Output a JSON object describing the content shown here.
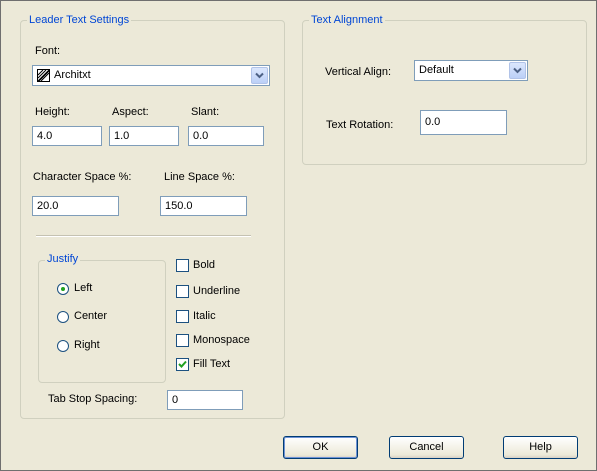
{
  "leader_group": {
    "legend": "Leader Text Settings",
    "font_label": "Font:",
    "font_value": "Architxt",
    "font_icon": "font-glyph-icon",
    "height_label": "Height:",
    "height_value": "4.0",
    "aspect_label": "Aspect:",
    "aspect_value": "1.0",
    "slant_label": "Slant:",
    "slant_value": "0.0",
    "char_space_label": "Character Space %:",
    "char_space_value": "20.0",
    "line_space_label": "Line Space %:",
    "line_space_value": "150.0",
    "justify": {
      "legend": "Justify",
      "options": [
        "Left",
        "Center",
        "Right"
      ],
      "selected": "Left"
    },
    "checkboxes": [
      {
        "label": "Bold",
        "checked": false
      },
      {
        "label": "Underline",
        "checked": false
      },
      {
        "label": "Italic",
        "checked": false
      },
      {
        "label": "Monospace",
        "checked": false
      },
      {
        "label": "Fill Text",
        "checked": true
      }
    ],
    "tab_stop_label": "Tab Stop Spacing:",
    "tab_stop_value": "0"
  },
  "alignment_group": {
    "legend": "Text Alignment",
    "vertical_label": "Vertical Align:",
    "vertical_value": "Default",
    "rotation_label": "Text Rotation:",
    "rotation_value": "0.0"
  },
  "buttons": {
    "ok": "OK",
    "cancel": "Cancel",
    "help": "Help"
  },
  "colors": {
    "dialog_bg": "#ece9d8",
    "legend_text": "#0046d5",
    "check_mark": "#21a121"
  }
}
